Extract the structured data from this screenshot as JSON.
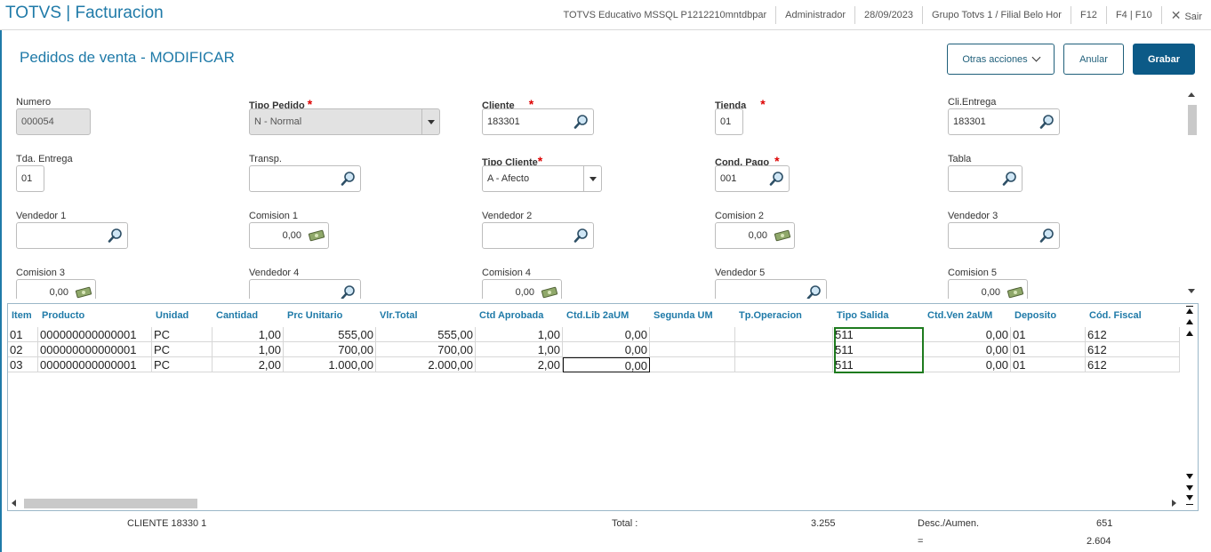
{
  "header": {
    "app_title": "TOTVS | Facturacion",
    "environment": "TOTVS Educativo MSSQL P1212210mntdbpar",
    "user": "Administrador",
    "date": "28/09/2023",
    "branch": "Grupo Totvs 1 / Filial Belo Hor",
    "f12": "F12",
    "f4f10": "F4 | F10",
    "exit_label": "Sair"
  },
  "page": {
    "title": "Pedidos de venta - MODIFICAR",
    "other_actions": "Otras acciones",
    "cancel": "Anular",
    "save": "Grabar"
  },
  "form": {
    "numero": {
      "label": "Numero",
      "value": "000054"
    },
    "tipo_pedido": {
      "label": "Tipo Pedido",
      "value": "N - Normal"
    },
    "cliente": {
      "label": "Cliente",
      "value": "183301"
    },
    "tienda": {
      "label": "Tienda",
      "value": "01"
    },
    "cli_entrega": {
      "label": "Cli.Entrega",
      "value": "183301"
    },
    "tda_entrega": {
      "label": "Tda. Entrega",
      "value": "01"
    },
    "transp": {
      "label": "Transp.",
      "value": ""
    },
    "tipo_cliente": {
      "label": "Tipo Cliente",
      "value": "A - Afecto"
    },
    "cond_pago": {
      "label": "Cond. Pago",
      "value": "001"
    },
    "tabla": {
      "label": "Tabla",
      "value": ""
    },
    "vendedor1": {
      "label": "Vendedor 1",
      "value": ""
    },
    "comision1": {
      "label": "Comision 1",
      "value": "0,00"
    },
    "vendedor2": {
      "label": "Vendedor 2",
      "value": ""
    },
    "comision2": {
      "label": "Comision 2",
      "value": "0,00"
    },
    "vendedor3": {
      "label": "Vendedor 3",
      "value": ""
    },
    "comision3": {
      "label": "Comision 3",
      "value": "0,00"
    },
    "vendedor4": {
      "label": "Vendedor 4",
      "value": ""
    },
    "comision4": {
      "label": "Comision 4",
      "value": "0,00"
    },
    "vendedor5": {
      "label": "Vendedor 5",
      "value": ""
    },
    "comision5": {
      "label": "Comision 5",
      "value": "0,00"
    },
    "required_mark": "*"
  },
  "grid": {
    "headers": [
      "Item",
      "Producto",
      "Unidad",
      "Cantidad",
      "Prc Unitario",
      "Vlr.Total",
      "Ctd Aprobada",
      "Ctd.Lib 2aUM",
      "Segunda UM",
      "Tp.Operacion",
      "Tipo Salida",
      "Ctd.Ven 2aUM",
      "Deposito",
      "Cód. Fiscal"
    ],
    "rows": [
      [
        "01",
        "000000000000001",
        "PC",
        "1,00",
        "555,00",
        "555,00",
        "1,00",
        "0,00",
        "",
        "",
        "511",
        "0,00",
        "01",
        "612"
      ],
      [
        "02",
        "000000000000001",
        "PC",
        "1,00",
        "700,00",
        "700,00",
        "1,00",
        "0,00",
        "",
        "",
        "511",
        "0,00",
        "01",
        "612"
      ],
      [
        "03",
        "000000000000001",
        "PC",
        "2,00",
        "1.000,00",
        "2.000,00",
        "2,00",
        "0,00",
        "",
        "",
        "511",
        "0,00",
        "01",
        "612"
      ]
    ]
  },
  "footer": {
    "client_name": "CLIENTE 18330 1",
    "total_label": "Total :",
    "total_value": "3.255",
    "desc_label": "Desc./Aumen.",
    "desc_value": "651",
    "eq_label": "=",
    "net_value": "2.604"
  },
  "colors": {
    "accent": "#1f7aa8",
    "primary_button": "#0c5a87",
    "highlight": "#1e7b1e"
  }
}
